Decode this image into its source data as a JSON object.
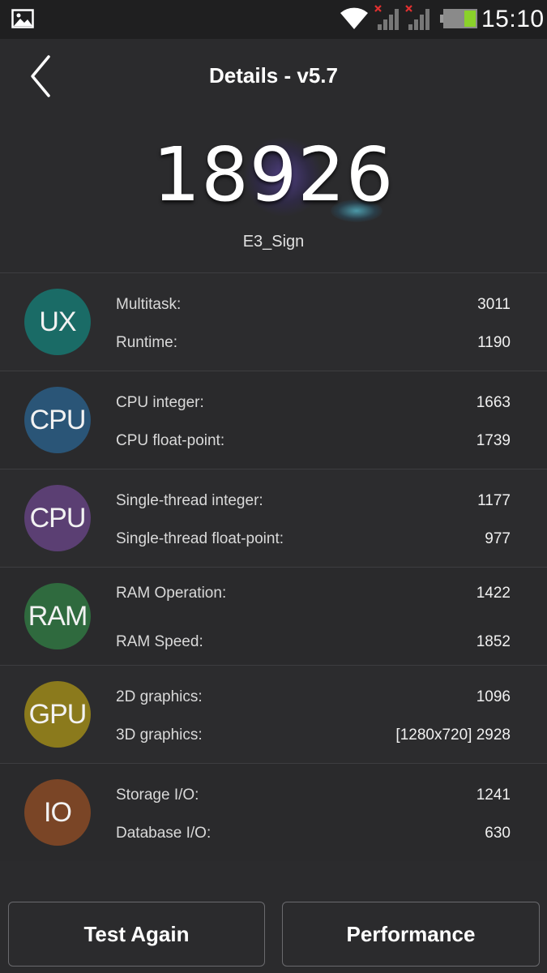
{
  "statusbar": {
    "time": "15:10",
    "icons": [
      "gallery-icon",
      "wifi-icon",
      "signal-off-icon",
      "signal-off-icon",
      "battery-icon"
    ],
    "colors": {
      "battery_level": "#8ad12a",
      "signal_x": "#e03030"
    }
  },
  "header": {
    "title": "Details - v5.7",
    "back_icon": "chevron-left-icon"
  },
  "score": {
    "total": "18926",
    "device": "E3_Sign"
  },
  "categories": [
    {
      "badge": "UX",
      "color": "#1a6b66",
      "metrics": [
        {
          "label": "Multitask:",
          "value": "3011"
        },
        {
          "label": "Runtime:",
          "value": "1190"
        }
      ]
    },
    {
      "badge": "CPU",
      "color": "#2a5577",
      "metrics": [
        {
          "label": "CPU integer:",
          "value": "1663"
        },
        {
          "label": "CPU float-point:",
          "value": "1739"
        }
      ]
    },
    {
      "badge": "CPU",
      "color": "#5b3f73",
      "metrics": [
        {
          "label": "Single-thread integer:",
          "value": "1177"
        },
        {
          "label": "Single-thread float-point:",
          "value": "977"
        }
      ]
    },
    {
      "badge": "RAM",
      "color": "#2f6a3e",
      "metrics": [
        {
          "label": "RAM Operation:",
          "value": "1422"
        },
        {
          "label": "RAM Speed:",
          "value": "1852"
        }
      ]
    },
    {
      "badge": "GPU",
      "color": "#8b7a1c",
      "metrics": [
        {
          "label": "2D graphics:",
          "value": "1096"
        },
        {
          "label": "3D graphics:",
          "value": "[1280x720] 2928"
        }
      ]
    },
    {
      "badge": "IO",
      "color": "#7a4526",
      "metrics": [
        {
          "label": "Storage I/O:",
          "value": "1241"
        },
        {
          "label": "Database I/O:",
          "value": "630"
        }
      ]
    }
  ],
  "buttons": {
    "test_again": "Test Again",
    "performance": "Performance"
  }
}
